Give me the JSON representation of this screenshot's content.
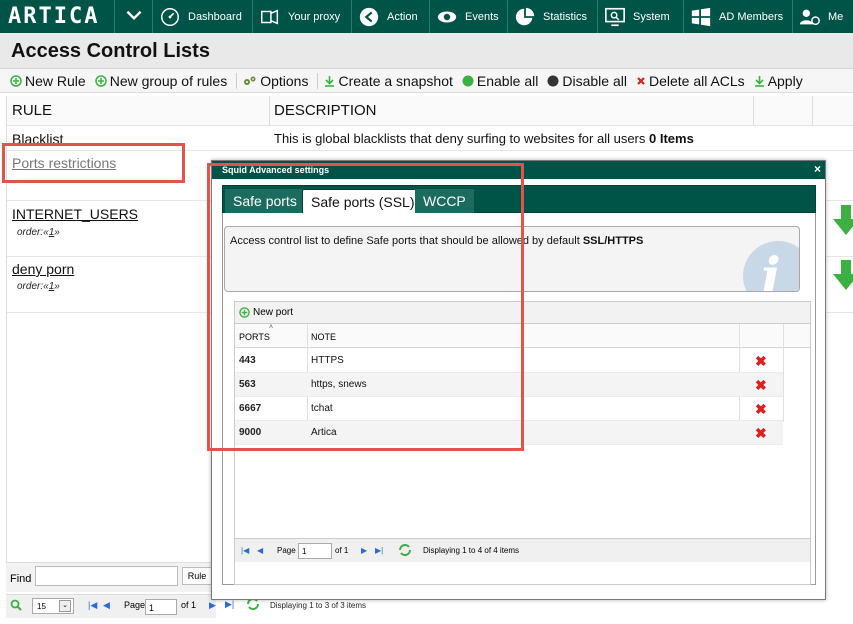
{
  "app": {
    "logo": "ARTICA"
  },
  "nav": [
    {
      "label": "Dashboard",
      "icon": "dashboard-icon"
    },
    {
      "label": "Your proxy",
      "icon": "proxy-icon"
    },
    {
      "label": "Action",
      "icon": "action-icon"
    },
    {
      "label": "Events",
      "icon": "events-icon"
    },
    {
      "label": "Statistics",
      "icon": "statistics-icon"
    },
    {
      "label": "System",
      "icon": "system-icon"
    },
    {
      "label": "AD Members",
      "icon": "windows-icon"
    },
    {
      "label": "Me",
      "icon": "users-icon"
    }
  ],
  "page": {
    "title": "Access Control Lists"
  },
  "toolbar": {
    "new_rule": "New Rule",
    "new_group": "New group of rules",
    "options": "Options",
    "snapshot": "Create a snapshot",
    "enable_all": "Enable all",
    "disable_all": "Disable all",
    "delete_all": "Delete all ACLs",
    "apply": "Apply"
  },
  "grid": {
    "col_rule": "RULE",
    "col_desc": "DESCRIPTION",
    "rows": [
      {
        "name": "Blacklist",
        "desc": "This is global blacklists that deny surfing to websites for all users",
        "items": "0 Items"
      },
      {
        "name": "Ports restrictions"
      },
      {
        "name": "INTERNET_USERS",
        "order_prefix": "order:«",
        "order": "1",
        "order_suffix": "»"
      },
      {
        "name": "deny porn",
        "order_prefix": "order:«",
        "order": "1",
        "order_suffix": "»"
      }
    ]
  },
  "find": {
    "label": "Find",
    "button": "Rule"
  },
  "pager": {
    "per_page": "15",
    "page_label": "Page",
    "page_value": "1",
    "of": "of 1",
    "status": "Displaying 1 to 3 of 3 items"
  },
  "modal": {
    "title": "Squid Advanced settings",
    "close": "×",
    "tabs": [
      "Safe ports",
      "Safe ports (SSL)",
      "WCCP"
    ],
    "info_prefix": "Access control list to define Safe ports that should be allowed by default ",
    "info_bold": "SSL/HTTPS",
    "new_port": "New port",
    "col_ports": "PORTS",
    "col_note": "NOTE",
    "ports": [
      {
        "port": "443",
        "note": "HTTPS"
      },
      {
        "port": "563",
        "note": "https, snews"
      },
      {
        "port": "6667",
        "note": "tchat"
      },
      {
        "port": "9000",
        "note": "Artica"
      }
    ],
    "pager": {
      "page_label": "Page",
      "page_value": "1",
      "of": "of 1",
      "status": "Displaying 1 to 4 of 4 items"
    }
  },
  "colors": {
    "nav_bg": "#005447",
    "highlight": "#e0544b",
    "delete_red": "#e0201b",
    "green": "#3cb043"
  }
}
